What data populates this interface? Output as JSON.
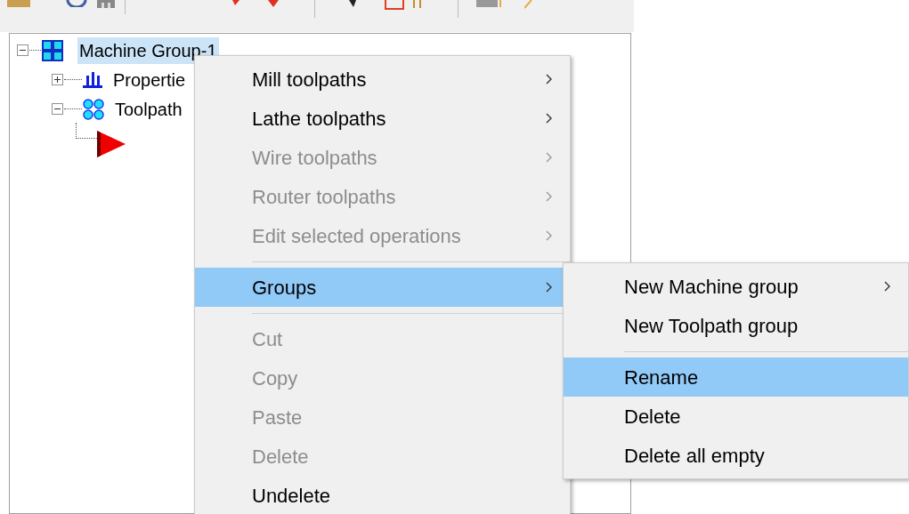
{
  "tree": [
    {
      "kind": "machine",
      "label": "Machine Group-1",
      "expanded": true,
      "selected": true,
      "children": [
        {
          "kind": "properties",
          "label": "Propertie",
          "expanded": false,
          "selected": false
        },
        {
          "kind": "toolpaths",
          "label": "Toolpath",
          "expanded": true,
          "selected": false,
          "children": [
            {
              "kind": "operation"
            }
          ]
        }
      ]
    }
  ],
  "context_menu": [
    {
      "kind": "item",
      "label": "Mill toolpaths",
      "disabled": false,
      "has_submenu": true,
      "selected": false
    },
    {
      "kind": "item",
      "label": "Lathe toolpaths",
      "disabled": false,
      "has_submenu": true,
      "selected": false
    },
    {
      "kind": "item",
      "label": "Wire toolpaths",
      "disabled": true,
      "has_submenu": true,
      "selected": false
    },
    {
      "kind": "item",
      "label": "Router toolpaths",
      "disabled": true,
      "has_submenu": true,
      "selected": false
    },
    {
      "kind": "item",
      "label": "Edit selected operations",
      "disabled": true,
      "has_submenu": true,
      "selected": false
    },
    {
      "kind": "separator"
    },
    {
      "kind": "item",
      "label": "Groups",
      "disabled": false,
      "has_submenu": true,
      "selected": true
    },
    {
      "kind": "separator"
    },
    {
      "kind": "item",
      "label": "Cut",
      "disabled": true,
      "has_submenu": false,
      "selected": false
    },
    {
      "kind": "item",
      "label": "Copy",
      "disabled": true,
      "has_submenu": false,
      "selected": false
    },
    {
      "kind": "item",
      "label": "Paste",
      "disabled": true,
      "has_submenu": false,
      "selected": false
    },
    {
      "kind": "item",
      "label": "Delete",
      "disabled": true,
      "has_submenu": false,
      "selected": false
    },
    {
      "kind": "item",
      "label": "Undelete",
      "disabled": false,
      "has_submenu": false,
      "selected": false
    }
  ],
  "submenu": [
    {
      "kind": "item",
      "label": "New Machine group",
      "disabled": false,
      "has_submenu": true,
      "selected": false
    },
    {
      "kind": "item",
      "label": "New Toolpath group",
      "disabled": false,
      "has_submenu": false,
      "selected": false
    },
    {
      "kind": "separator"
    },
    {
      "kind": "item",
      "label": "Rename",
      "disabled": false,
      "has_submenu": false,
      "selected": true
    },
    {
      "kind": "item",
      "label": "Delete",
      "disabled": false,
      "has_submenu": false,
      "selected": false
    },
    {
      "kind": "item",
      "label": "Delete all empty",
      "disabled": false,
      "has_submenu": false,
      "selected": false
    }
  ]
}
